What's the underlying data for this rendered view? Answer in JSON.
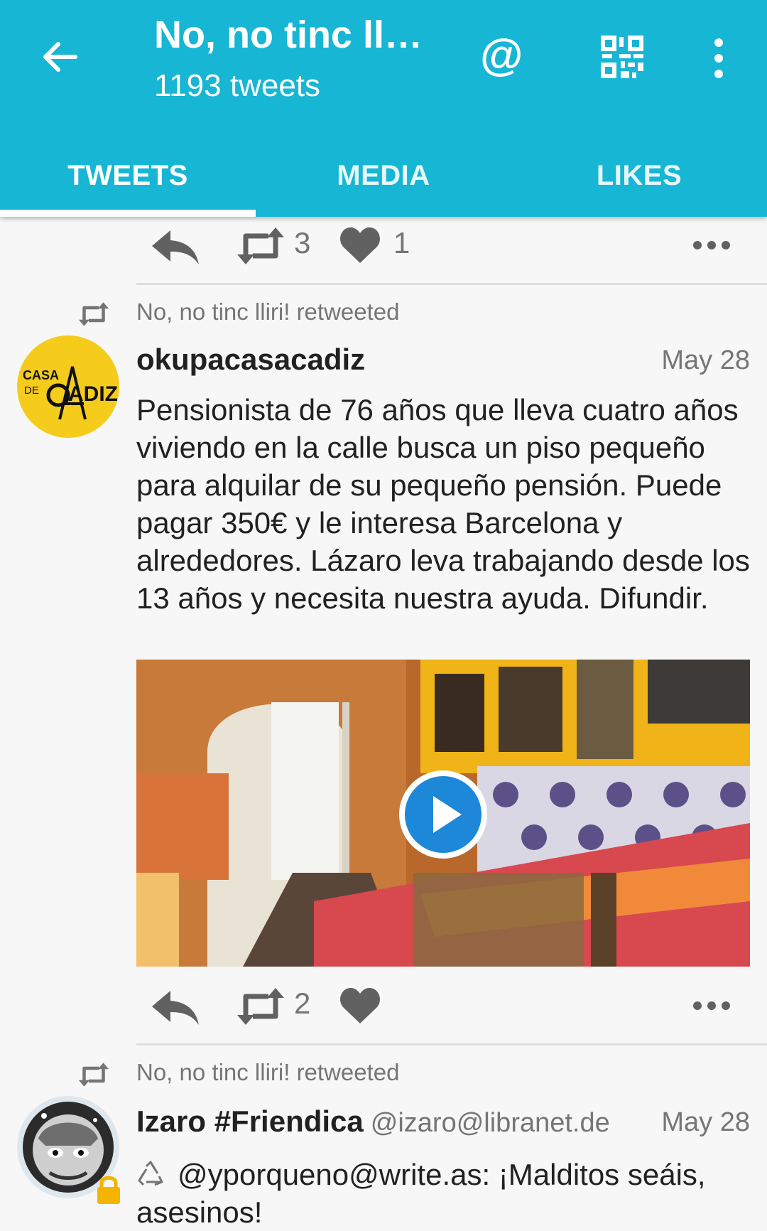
{
  "header": {
    "title": "No, no tinc ll…",
    "subtitle": "1193 tweets",
    "back_icon": "arrow-back-icon",
    "mention_label": "@",
    "qr_icon": "qr-code-icon",
    "more_icon": "more-vert-icon",
    "background": "#16b6d4"
  },
  "tabs": [
    {
      "label": "TWEETS",
      "active": true
    },
    {
      "label": "MEDIA",
      "active": false
    },
    {
      "label": "LIKES",
      "active": false
    }
  ],
  "feed": {
    "top_actions": {
      "retweets": "3",
      "likes": "1"
    },
    "tweets": [
      {
        "retweeted_by": "No, no tinc lliri! retweeted",
        "author": "okupacasacadiz",
        "handle": "",
        "date": "May 28",
        "avatar_text_top": "CASA",
        "avatar_text_mid": "DE",
        "avatar_text_main": "ADIZ",
        "avatar_color": "#f5cc1c",
        "text": "Pensionista de 76 años que lleva cuatro años viviendo en la calle busca un piso pequeño para alquilar de su pequeño pensión. Puede pagar 350€ y le interesa Barcelona y alrededores. Lázaro leva trabajando desde los 13 años y necesita nuestra ayuda. Difundir.",
        "media": "video",
        "retweets": "2",
        "likes": ""
      },
      {
        "retweeted_by": "No, no tinc lliri! retweeted",
        "author": "Izaro #Friendica",
        "handle": "@izaro@libranet.de",
        "date": "May 28",
        "text_icon": "recycle-icon",
        "text": "@yporqueno@write.as:  ¡Malditos seáis, asesinos!"
      }
    ]
  }
}
